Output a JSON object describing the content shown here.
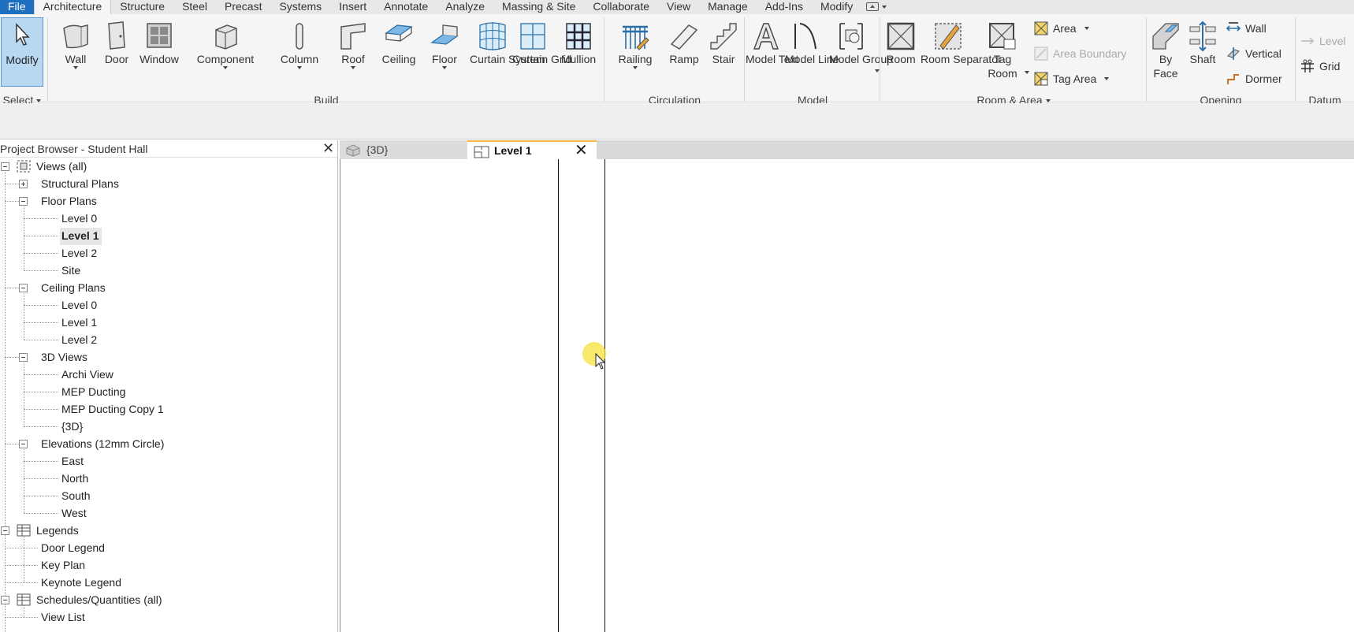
{
  "menu": {
    "tabs": [
      "File",
      "Architecture",
      "Structure",
      "Steel",
      "Precast",
      "Systems",
      "Insert",
      "Annotate",
      "Analyze",
      "Massing & Site",
      "Collaborate",
      "View",
      "Manage",
      "Add-Ins",
      "Modify"
    ],
    "active_tab": "Architecture"
  },
  "ribbon": {
    "select": {
      "modify": "Modify",
      "select_label": "Select"
    },
    "build": {
      "label": "Build",
      "tools": [
        "Wall",
        "Door",
        "Window",
        "Component",
        "Column",
        "Roof",
        "Ceiling",
        "Floor",
        "Curtain System",
        "Curtain Grid",
        "Mullion"
      ]
    },
    "circulation": {
      "label": "Circulation",
      "tools": [
        "Railing",
        "Ramp",
        "Stair"
      ]
    },
    "model": {
      "label": "Model",
      "tools": [
        "Model Text",
        "Model Line",
        "Model Group"
      ]
    },
    "room_area": {
      "label": "Room & Area",
      "tools": [
        "Room",
        "Room Separator",
        "Tag Room"
      ],
      "small": [
        "Area",
        "Area Boundary",
        "Tag Area"
      ]
    },
    "opening": {
      "label": "Opening",
      "tools": [
        "By Face",
        "Shaft"
      ],
      "small": [
        "Wall",
        "Vertical",
        "Dormer"
      ]
    },
    "datum": {
      "label": "Datum",
      "small": [
        "Level",
        "Grid"
      ]
    }
  },
  "browser": {
    "title": "Project Browser - Student Hall",
    "tree": [
      {
        "label": "Views (all)",
        "level": 0,
        "expander": "minus"
      },
      {
        "label": "Structural Plans",
        "level": 1,
        "expander": "plus"
      },
      {
        "label": "Floor Plans",
        "level": 1,
        "expander": "minus"
      },
      {
        "label": "Level 0",
        "level": 2
      },
      {
        "label": "Level 1",
        "level": 2,
        "selected": true
      },
      {
        "label": "Level 2",
        "level": 2
      },
      {
        "label": "Site",
        "level": 2
      },
      {
        "label": "Ceiling Plans",
        "level": 1,
        "expander": "minus"
      },
      {
        "label": "Level 0",
        "level": 2
      },
      {
        "label": "Level 1",
        "level": 2
      },
      {
        "label": "Level 2",
        "level": 2
      },
      {
        "label": "3D Views",
        "level": 1,
        "expander": "minus"
      },
      {
        "label": "Archi View",
        "level": 2
      },
      {
        "label": "MEP Ducting",
        "level": 2
      },
      {
        "label": "MEP Ducting Copy 1",
        "level": 2
      },
      {
        "label": "{3D}",
        "level": 2
      },
      {
        "label": "Elevations (12mm Circle)",
        "level": 1,
        "expander": "minus"
      },
      {
        "label": "East",
        "level": 2
      },
      {
        "label": "North",
        "level": 2
      },
      {
        "label": "South",
        "level": 2
      },
      {
        "label": "West",
        "level": 2
      },
      {
        "label": "Legends",
        "level": 0,
        "expander": "minus"
      },
      {
        "label": "Door Legend",
        "level": 1
      },
      {
        "label": "Key Plan",
        "level": 1
      },
      {
        "label": "Keynote Legend",
        "level": 1
      },
      {
        "label": "Schedules/Quantities (all)",
        "level": 0,
        "expander": "minus"
      },
      {
        "label": "View List",
        "level": 1
      }
    ]
  },
  "view_tabs": [
    {
      "label": "{3D}",
      "active": false
    },
    {
      "label": "Level 1",
      "active": true
    }
  ],
  "colors": {
    "file_tab": "#1f6fc0",
    "modify_highlight": "#b8d8f2",
    "active_tab_accent": "#f5b94a",
    "cursor_highlight": "#f5e13c"
  }
}
